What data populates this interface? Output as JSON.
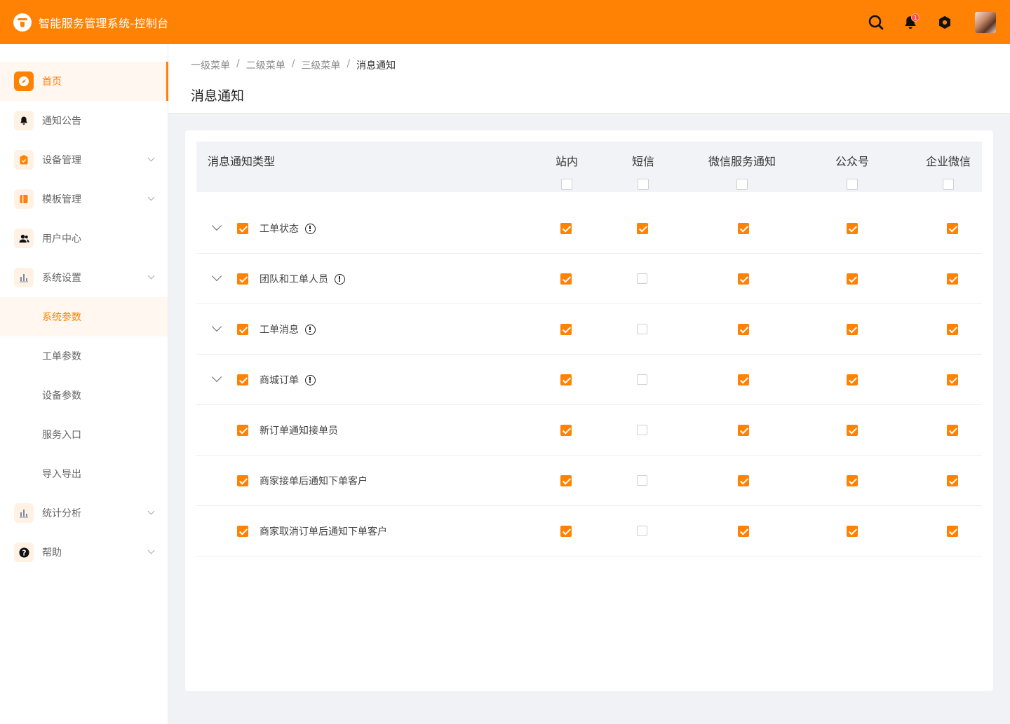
{
  "app": {
    "title": "智能服务管理系统-控制台"
  },
  "header": {
    "notification_count": "1",
    "icons": [
      "search-icon",
      "bell-icon",
      "settings-icon",
      "avatar"
    ]
  },
  "sidebar": {
    "items": [
      {
        "label": "首页",
        "icon": "compass-icon",
        "active": true,
        "expandable": false
      },
      {
        "label": "通知公告",
        "icon": "bell-icon",
        "active": false,
        "expandable": false
      },
      {
        "label": "设备管理",
        "icon": "clipboard-icon",
        "active": false,
        "expandable": true
      },
      {
        "label": "模板管理",
        "icon": "book-icon",
        "active": false,
        "expandable": true
      },
      {
        "label": "用户中心",
        "icon": "users-icon",
        "active": false,
        "expandable": false
      },
      {
        "label": "系统设置",
        "icon": "chart-icon",
        "active": false,
        "expandable": true
      },
      {
        "label": "系统参数",
        "sub": true,
        "active": true
      },
      {
        "label": "工单参数",
        "sub": true,
        "active": false
      },
      {
        "label": "设备参数",
        "sub": true,
        "active": false
      },
      {
        "label": "服务入口",
        "sub": true,
        "active": false
      },
      {
        "label": "导入导出",
        "sub": true,
        "active": false
      },
      {
        "label": "统计分析",
        "icon": "chart-icon",
        "active": false,
        "expandable": true
      },
      {
        "label": "帮助",
        "icon": "help-icon",
        "active": false,
        "expandable": true
      }
    ]
  },
  "breadcrumb": [
    "一级菜单",
    "二级菜单",
    "三级菜单",
    "消息通知"
  ],
  "page": {
    "title": "消息通知"
  },
  "table": {
    "type_header": "消息通知类型",
    "columns": [
      "站内",
      "短信",
      "微信服务通知",
      "公众号",
      "企业微信"
    ],
    "header_checks": [
      false,
      false,
      false,
      false,
      false
    ],
    "rows": [
      {
        "label": "工单状态",
        "expandable": true,
        "info": true,
        "checked": true,
        "values": [
          true,
          true,
          true,
          true,
          true
        ]
      },
      {
        "label": "团队和工单人员",
        "expandable": true,
        "info": true,
        "checked": true,
        "values": [
          true,
          false,
          true,
          true,
          true
        ]
      },
      {
        "label": "工单消息",
        "expandable": true,
        "info": true,
        "checked": true,
        "values": [
          true,
          false,
          true,
          true,
          true
        ]
      },
      {
        "label": "商城订单",
        "expandable": true,
        "info": true,
        "checked": true,
        "values": [
          true,
          false,
          true,
          true,
          true
        ]
      },
      {
        "label": "新订单通知接单员",
        "expandable": false,
        "info": false,
        "checked": true,
        "values": [
          true,
          false,
          true,
          true,
          true
        ]
      },
      {
        "label": "商家接单后通知下单客户",
        "expandable": false,
        "info": false,
        "checked": true,
        "values": [
          true,
          false,
          true,
          true,
          true
        ]
      },
      {
        "label": "商家取消订单后通知下单客户",
        "expandable": false,
        "info": false,
        "checked": true,
        "values": [
          true,
          false,
          true,
          true,
          true
        ]
      }
    ]
  },
  "colors": {
    "accent": "#ff8204",
    "active_bg": "#fff7f0"
  }
}
